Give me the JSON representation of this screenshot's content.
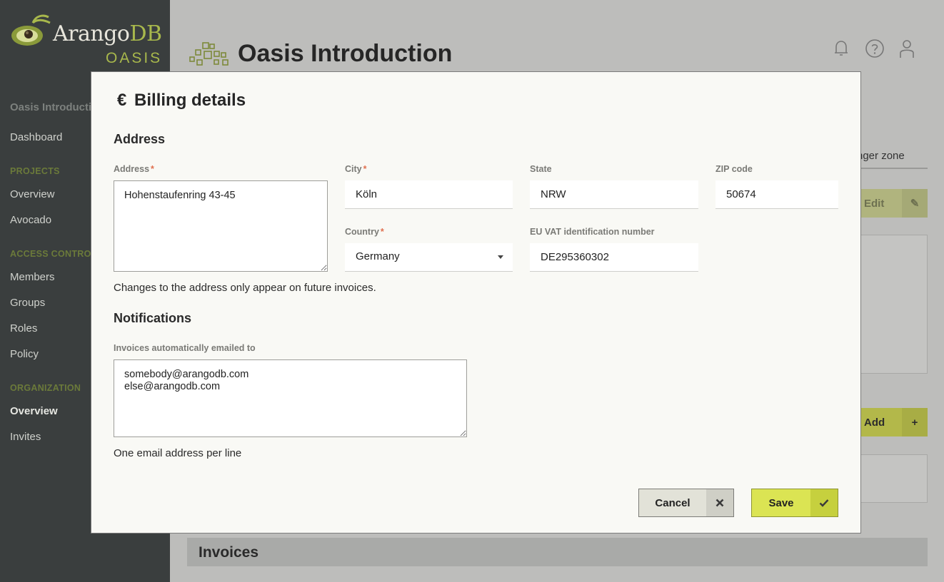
{
  "app": {
    "logo_word_main": "Arango",
    "logo_word_accent": "DB",
    "logo_sub": "OASIS"
  },
  "sidebar": {
    "top_item": "Oasis Introducti",
    "dashboard": "Dashboard",
    "sections": {
      "projects": "PROJECTS",
      "access_control": "ACCESS CONTRO",
      "organization": "ORGANIZATION"
    },
    "projects_items": [
      "Overview",
      "Avocado"
    ],
    "access_items": [
      "Members",
      "Groups",
      "Roles",
      "Policy"
    ],
    "organization_items": [
      "Overview",
      "Invites"
    ]
  },
  "page": {
    "title": "Oasis Introduction",
    "bg_tab": "nger zone",
    "bg_edit": "Edit",
    "bg_add": "Add",
    "invoices_title": "Invoices"
  },
  "modal": {
    "title_symbol": "€",
    "title": "Billing details",
    "address_section": "Address",
    "fields": {
      "address_label": "Address",
      "address_value": "Hohenstaufenring 43-45",
      "city_label": "City",
      "city_value": "Köln",
      "state_label": "State",
      "state_value": "NRW",
      "zip_label": "ZIP code",
      "zip_value": "50674",
      "country_label": "Country",
      "country_value": "Germany",
      "vat_label": "EU VAT identification number",
      "vat_value": "DE295360302"
    },
    "address_hint": "Changes to the address only appear on future invoices.",
    "notifications_section": "Notifications",
    "emails_label": "Invoices automatically emailed to",
    "emails_value": "somebody@arangodb.com\nelse@arangodb.com",
    "emails_hint": "One email address per line",
    "cancel_label": "Cancel",
    "save_label": "Save"
  },
  "colors": {
    "accent_green": "#dbe453",
    "required_star": "#e07050",
    "sidebar_bg": "#3a3e3e"
  }
}
